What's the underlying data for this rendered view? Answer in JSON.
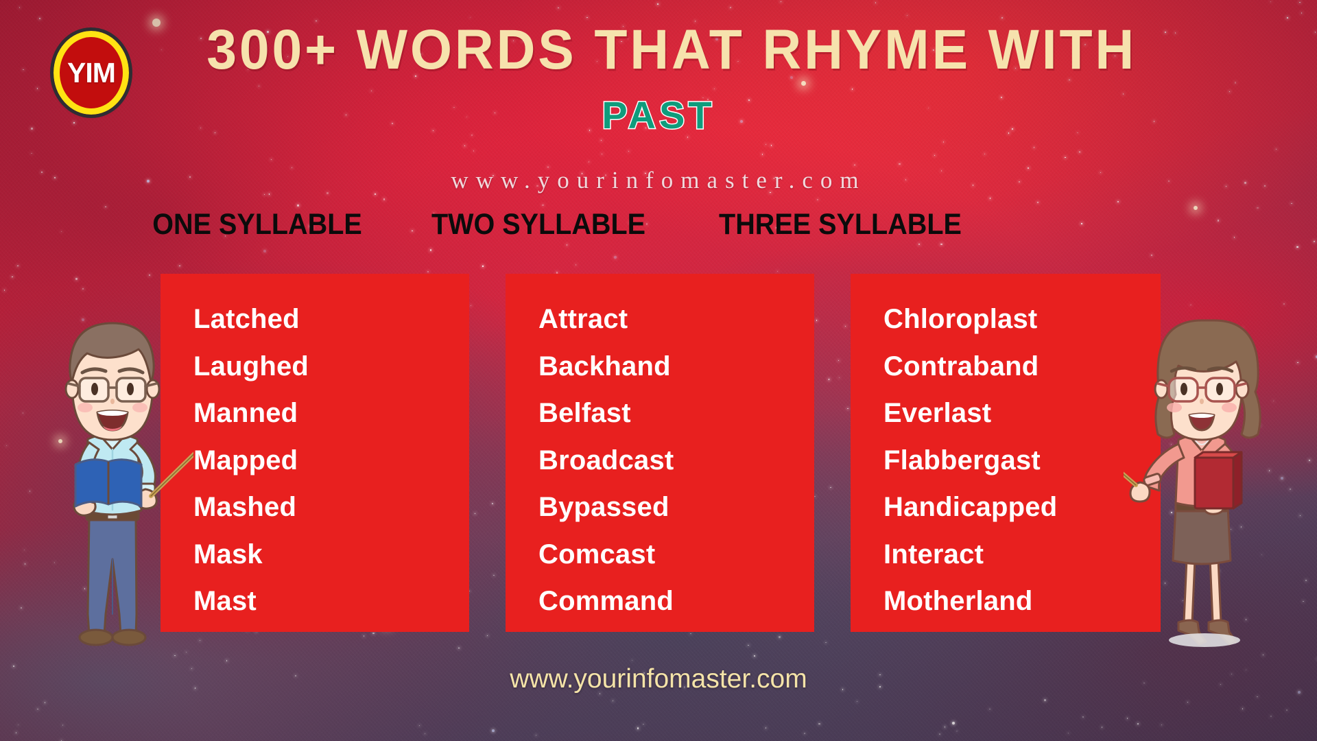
{
  "brand": {
    "logo_text": "YIM",
    "logo_ring_color": "#ffe313",
    "logo_fill_color": "#c20d0d"
  },
  "header": {
    "title": "300+ WORDS THAT RHYME WITH",
    "subtitle": "PAST",
    "title_color": "#f6e2ad",
    "subtitle_color": "#0f9c7c",
    "url_top": "www.yourinfomaster.com"
  },
  "footer": {
    "url_bottom": "www.yourinfomaster.com",
    "url_color": "#f4e3a8"
  },
  "panel_color": "#e8201f",
  "columns": [
    {
      "header": "ONE SYLLABLE",
      "words": [
        "Latched",
        "Laughed",
        "Manned",
        "Mapped",
        "Mashed",
        "Mask",
        "Mast"
      ]
    },
    {
      "header": "TWO SYLLABLE",
      "words": [
        "Attract",
        "Backhand",
        "Belfast",
        "Broadcast",
        "Bypassed",
        "Comcast",
        "Command"
      ]
    },
    {
      "header": "THREE SYLLABLE",
      "words": [
        "Chloroplast",
        "Contraband",
        "Everlast",
        "Flabbergast",
        "Handicapped",
        "Interact",
        "Motherland"
      ]
    }
  ],
  "illustrations": {
    "left": "male-teacher-with-book-and-pointer",
    "right": "female-teacher-with-book-and-pointer"
  }
}
